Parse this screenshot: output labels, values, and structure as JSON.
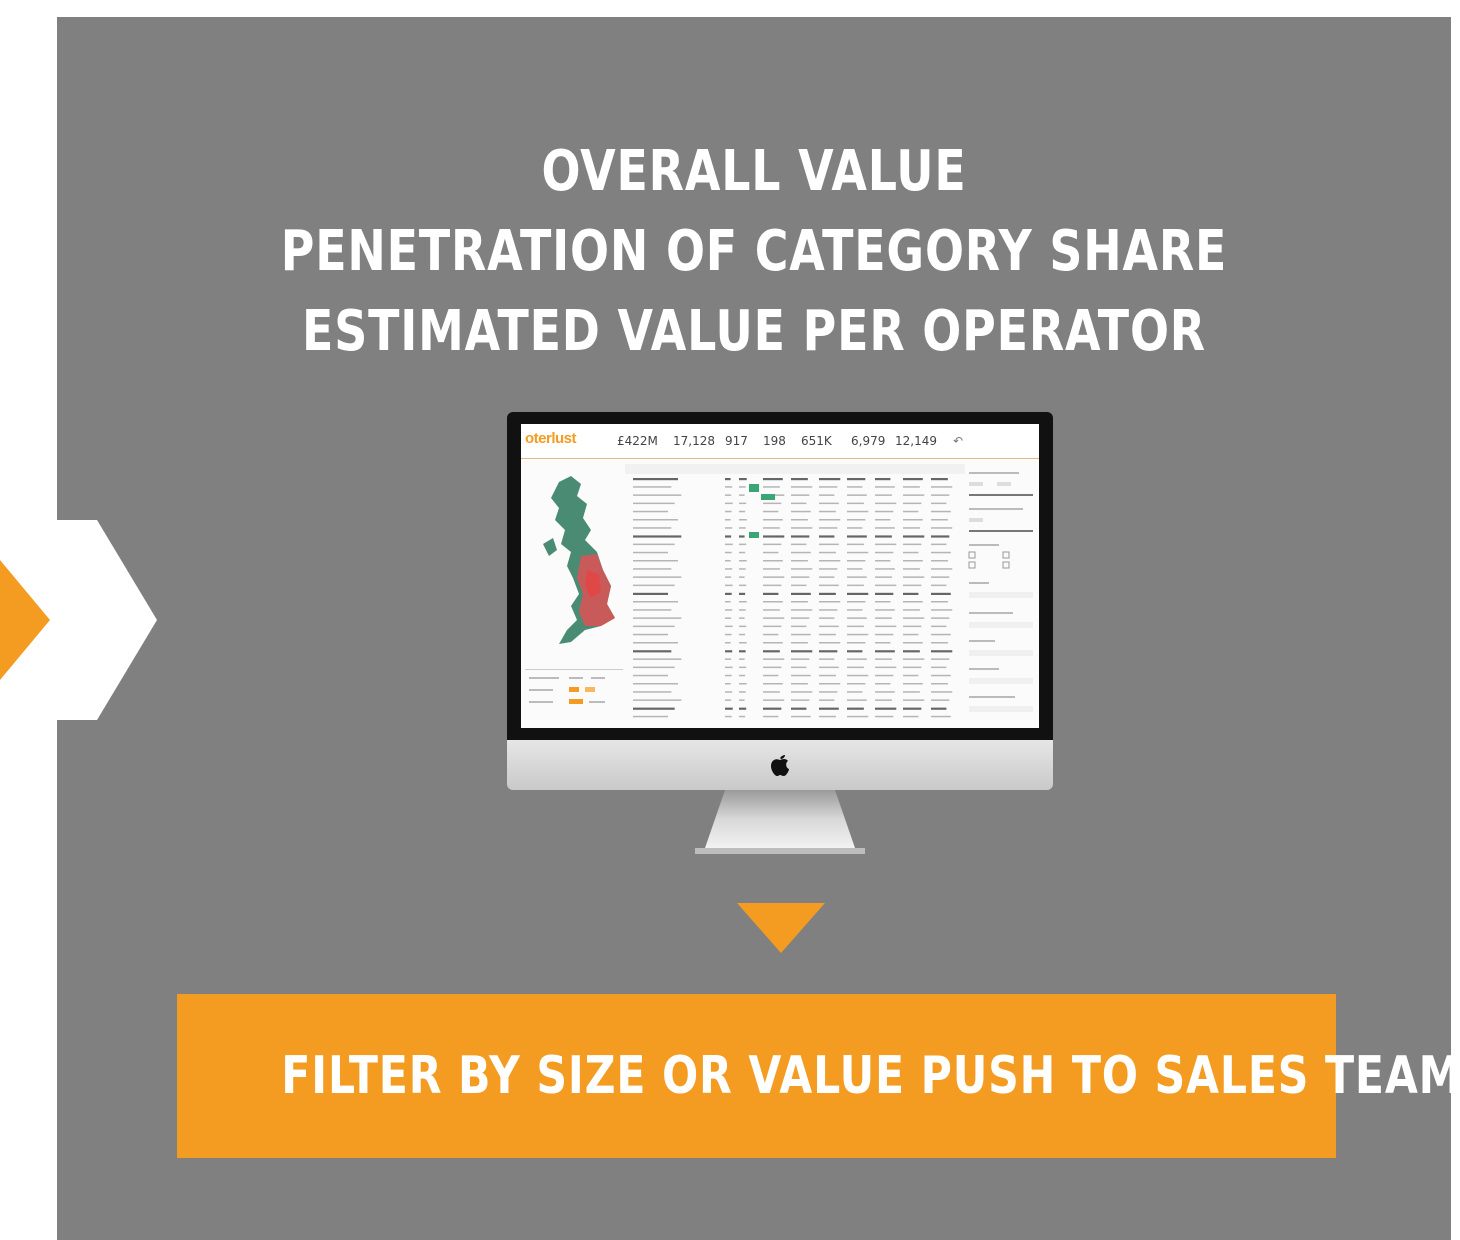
{
  "headline": {
    "line1": "OVERALL VALUE",
    "line2": "PENETRATION OF CATEGORY SHARE",
    "line3": "ESTIMATED VALUE PER OPERATOR"
  },
  "dashboard": {
    "brand": "oterlust",
    "kpis": [
      "£422M",
      "17,128",
      "917",
      "198",
      "651K",
      "6,979",
      "12,149"
    ]
  },
  "cta": {
    "label": "FILTER BY SIZE OR VALUE PUSH TO SALES TEAM"
  },
  "colors": {
    "background": "#808080",
    "accent": "#f39c21",
    "text": "#ffffff"
  },
  "icons": [
    "chevron-right-icon",
    "apple-logo-icon",
    "triangle-down-icon"
  ]
}
